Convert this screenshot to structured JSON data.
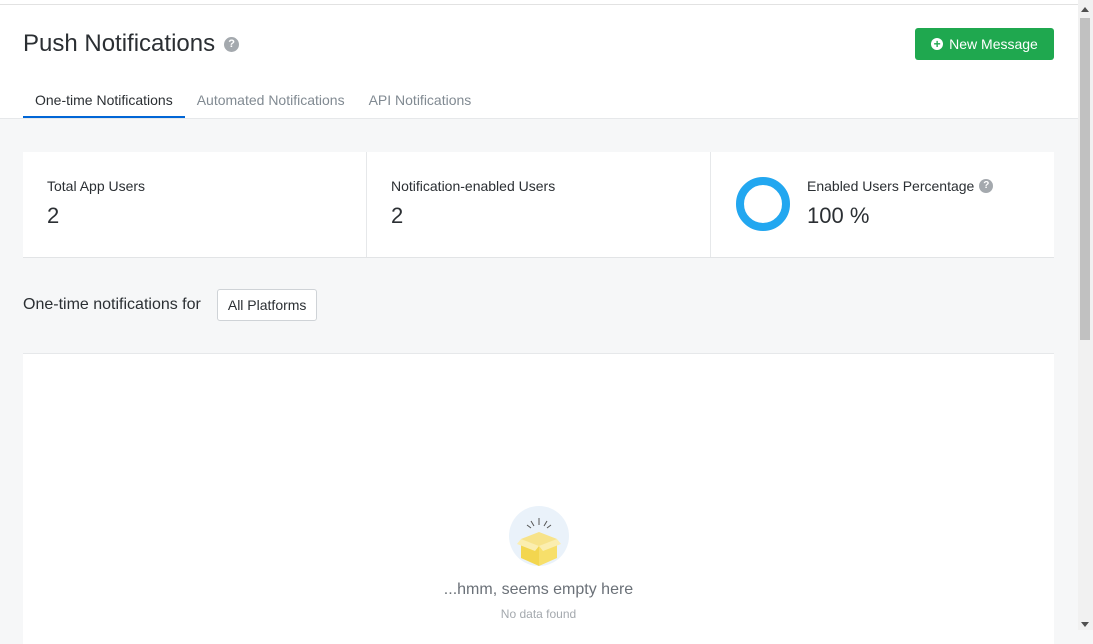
{
  "header": {
    "title": "Push Notifications",
    "help_icon": "?",
    "new_button_label": "New Message",
    "new_button_icon": "plus-circle-icon"
  },
  "tabs": [
    {
      "label": "One-time Notifications",
      "active": true
    },
    {
      "label": "Automated Notifications",
      "active": false
    },
    {
      "label": "API Notifications",
      "active": false
    }
  ],
  "stats": {
    "total_users": {
      "label": "Total App Users",
      "value": "2"
    },
    "enabled_users": {
      "label": "Notification-enabled Users",
      "value": "2"
    },
    "percentage": {
      "label": "Enabled Users Percentage",
      "value": "100 %",
      "fraction": 1.0
    }
  },
  "filter": {
    "label": "One-time notifications for",
    "platform": "All Platforms"
  },
  "empty_state": {
    "title": "...hmm, seems empty here",
    "subtitle": "No data found",
    "icon": "empty-box-icon"
  },
  "colors": {
    "accent": "#0166d6",
    "primary_button": "#1fa84f",
    "donut": "#22a7f0"
  }
}
